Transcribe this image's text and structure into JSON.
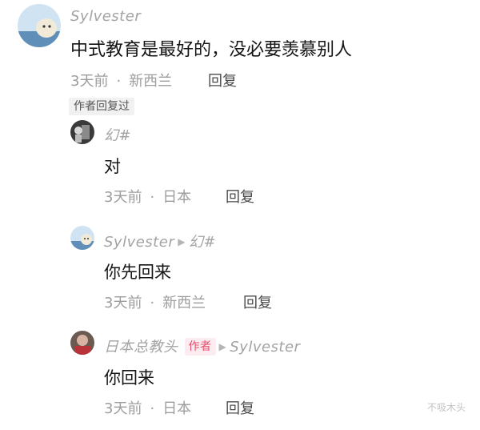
{
  "comments": {
    "root": {
      "username": "Sylvester",
      "content": "中式教育是最好的，没必要羡慕别人",
      "time": "3天前",
      "location": "新西兰",
      "reply_label": "回复",
      "author_replied_tag": "作者回复过"
    },
    "replies": [
      {
        "username": "幻#",
        "content": "对",
        "time": "3天前",
        "location": "日本",
        "reply_label": "回复"
      },
      {
        "username": "Sylvester",
        "reply_to": "幻#",
        "content": "你先回来",
        "time": "3天前",
        "location": "新西兰",
        "reply_label": "回复"
      },
      {
        "username": "日本总教头",
        "author_badge": "作者",
        "reply_to": "Sylvester",
        "content": "你回来",
        "time": "3天前",
        "location": "日本",
        "reply_label": "回复"
      }
    ]
  },
  "watermark": "不吸木头",
  "colors": {
    "username": "#a3a3a3",
    "meta": "#9d9d9d",
    "author_badge_bg": "#fdecef",
    "author_badge_text": "#e0506d"
  }
}
